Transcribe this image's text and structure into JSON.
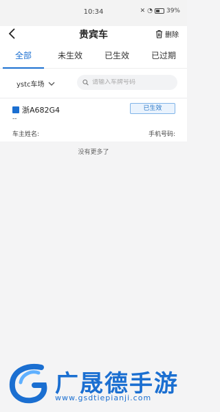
{
  "status_bar": {
    "time": "10:34",
    "battery": "39%"
  },
  "header": {
    "title": "贵宾车",
    "back_icon": "chevron-left-icon",
    "delete_label": "删除",
    "delete_icon": "trash-icon"
  },
  "tabs": [
    {
      "label": "全部",
      "active": true
    },
    {
      "label": "未生效",
      "active": false
    },
    {
      "label": "已生效",
      "active": false
    },
    {
      "label": "已过期",
      "active": false
    }
  ],
  "filter": {
    "parking_lot": "ystc车场",
    "search_placeholder": "请输入车牌号码"
  },
  "records": [
    {
      "plate": "浙A682G4",
      "status": "已生效",
      "dash": "--",
      "owner_label": "车主姓名:",
      "phone_label": "手机号码:"
    }
  ],
  "list_footer": "没有更多了",
  "watermark": {
    "brand": "广晟德手游",
    "url": "www.gsdtiepianji.com"
  },
  "colors": {
    "accent": "#1b6fd1",
    "background": "#f4f4f5",
    "badge_border": "#7fb3e8"
  }
}
